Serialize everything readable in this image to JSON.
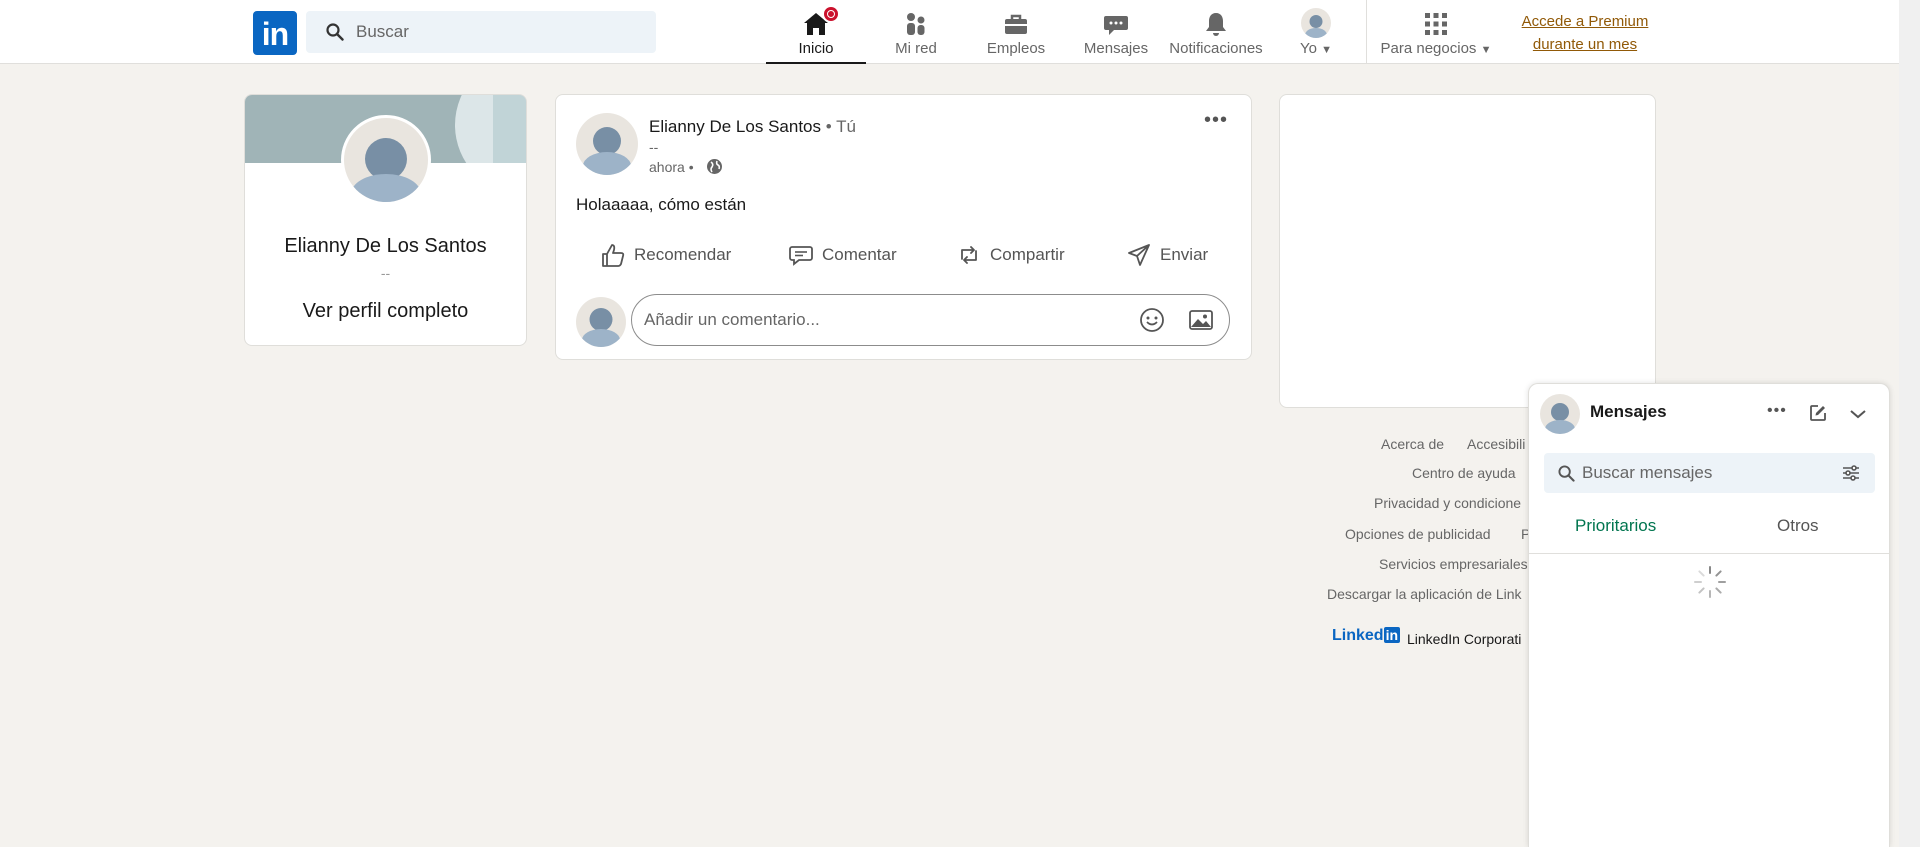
{
  "header": {
    "logo_text": "in",
    "search_placeholder": "Buscar",
    "nav": [
      {
        "label": "Inicio",
        "icon": "home-icon"
      },
      {
        "label": "Mi red",
        "icon": "network-icon"
      },
      {
        "label": "Empleos",
        "icon": "briefcase-icon"
      },
      {
        "label": "Mensajes",
        "icon": "messaging-icon"
      },
      {
        "label": "Notificaciones",
        "icon": "bell-icon"
      },
      {
        "label": "Yo",
        "icon": "avatar-icon"
      },
      {
        "label": "Para negocios",
        "icon": "grid-icon"
      }
    ],
    "premium_line1": "Accede a Premium",
    "premium_line2": "durante un mes"
  },
  "profile": {
    "name": "Elianny De Los Santos",
    "headline": "--",
    "view_profile": "Ver perfil completo"
  },
  "post": {
    "author": "Elianny De Los Santos",
    "you_tag": " • Tú",
    "headline": "--",
    "time": "ahora •",
    "text": "Holaaaaa, cómo están",
    "actions": [
      "Recomendar",
      "Comentar",
      "Compartir",
      "Enviar"
    ],
    "comment_placeholder": "Añadir un comentario..."
  },
  "footer": {
    "links": [
      "Acerca de",
      "Accesibili",
      "Centro de ayuda",
      "Privacidad y condicione",
      "Opciones de publicidad",
      "P",
      "Servicios empresariales",
      "Descargar la aplicación de Link"
    ],
    "brand": "Linked",
    "brand_in": "in",
    "corp": "LinkedIn Corporati"
  },
  "messaging": {
    "title": "Mensajes",
    "search_placeholder": "Buscar mensajes",
    "tabs": [
      "Prioritarios",
      "Otros"
    ]
  },
  "colors": {
    "brand": "#0a66c2",
    "premium": "#915907",
    "active_tab": "#01754f",
    "badge": "#cb112d"
  }
}
